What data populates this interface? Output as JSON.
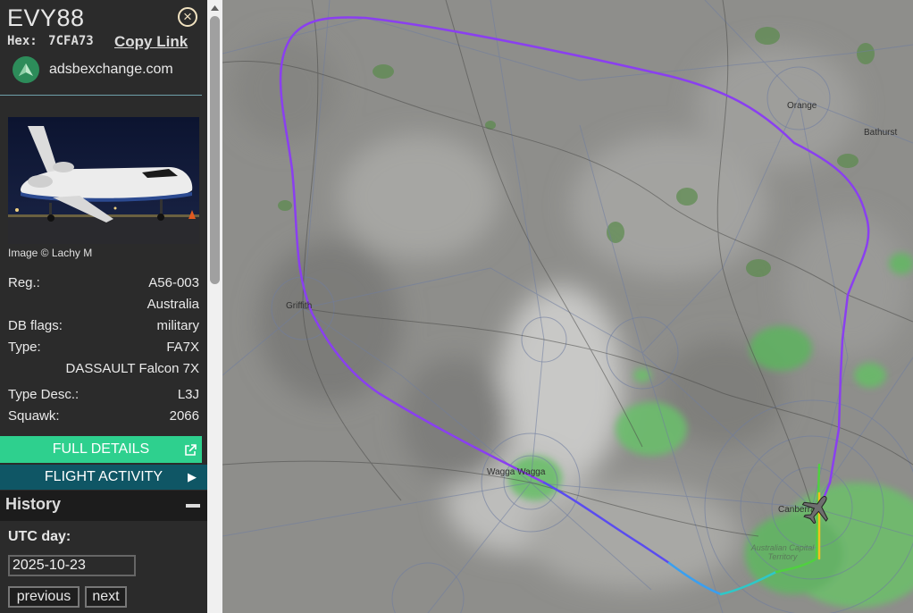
{
  "aircraft": {
    "callsign": "EVY88",
    "hex_label": "Hex:",
    "hex": "7CFA73",
    "copy_link": "Copy Link",
    "source": "adsbexchange.com",
    "image_credit": "Image © Lachy M"
  },
  "details": {
    "reg_label": "Reg.:",
    "reg": "A56-003",
    "country": "Australia",
    "dbflags_label": "DB flags:",
    "dbflags": "military",
    "type_label": "Type:",
    "type": "FA7X",
    "type_name": "DASSAULT Falcon 7X",
    "typedesc_label": "Type Desc.:",
    "typedesc": "L3J",
    "squawk_label": "Squawk:",
    "squawk": "2066"
  },
  "buttons": {
    "full_details": "FULL DETAILS",
    "flight_activity": "FLIGHT ACTIVITY"
  },
  "history": {
    "title": "History",
    "utc_label": "UTC day:",
    "date": "2025-10-23",
    "previous": "previous",
    "next": "next"
  },
  "map": {
    "cities": [
      "Orange",
      "Bathurst",
      "Griffith",
      "Wagga Wagga",
      "Canberra",
      "Australian Capital Territory"
    ],
    "track_colors": [
      "#8a3ff0",
      "#5a4cf0",
      "#3aa0f0",
      "#2ec8c8",
      "#50d040",
      "#f0c020"
    ]
  },
  "colors": {
    "full_details_bg": "#2ed08e",
    "flight_activity_bg": "#0f5665",
    "sidebar_bg": "#2b2b2b"
  }
}
